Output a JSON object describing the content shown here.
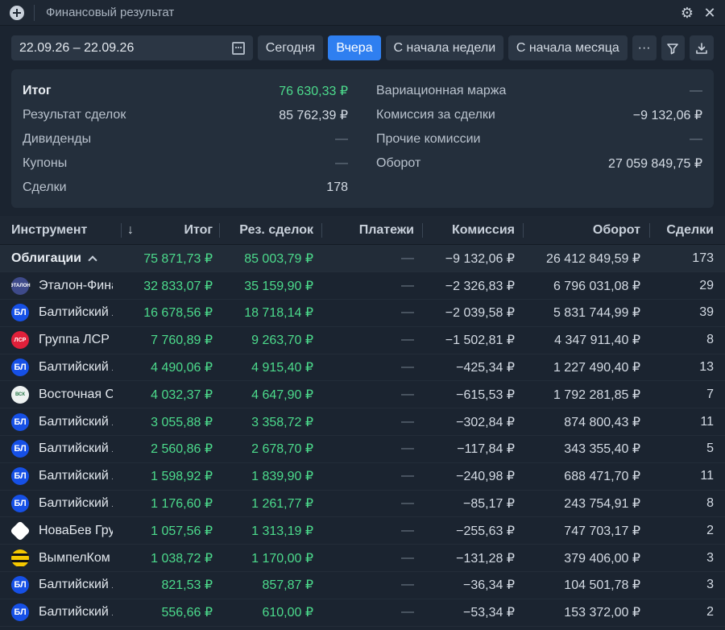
{
  "window": {
    "title": "Финансовый результат"
  },
  "toolbar": {
    "date_range": "22.09.26 – 22.09.26",
    "buttons": [
      "Сегодня",
      "Вчера",
      "С начала недели",
      "С начала месяца"
    ],
    "active_button": "Вчера",
    "more_label": "···"
  },
  "summary": {
    "left": [
      {
        "label": "Итог",
        "value": "76 630,33 ₽"
      },
      {
        "label": "Результат сделок",
        "value": "85 762,39 ₽"
      },
      {
        "label": "Дивиденды",
        "value": "—"
      },
      {
        "label": "Купоны",
        "value": "—"
      },
      {
        "label": "Сделки",
        "value": "178"
      }
    ],
    "right": [
      {
        "label": "Вариационная маржа",
        "value": "—"
      },
      {
        "label": "Комиссия за сделки",
        "value": "−9 132,06 ₽"
      },
      {
        "label": "Прочие комиссии",
        "value": "—"
      },
      {
        "label": "Оборот",
        "value": "27 059 849,75 ₽"
      }
    ]
  },
  "table": {
    "columns": [
      "Инструмент",
      "Итог",
      "Рез. сделок",
      "Платежи",
      "Комиссия",
      "Оборот",
      "Сделки"
    ],
    "sort_indicator": "↓",
    "group": {
      "name": "Облигации",
      "total": "75 871,73 ₽",
      "deals_result": "85 003,79 ₽",
      "payments": "—",
      "commission": "−9 132,06 ₽",
      "turnover": "26 412 849,59 ₽",
      "deals": "173"
    },
    "rows": [
      {
        "logo": "etalon",
        "logo_text": "ЭТАЛОН",
        "name": "Эталон-Финанс",
        "total": "32 833,07 ₽",
        "deals_result": "35 159,90 ₽",
        "payments": "—",
        "commission": "−2 326,83 ₽",
        "turnover": "6 796 031,08 ₽",
        "deals": "29"
      },
      {
        "logo": "bl",
        "logo_text": "БЛ",
        "name": "Балтийский лизинг",
        "total": "16 678,56 ₽",
        "deals_result": "18 718,14 ₽",
        "payments": "—",
        "commission": "−2 039,58 ₽",
        "turnover": "5 831 744,99 ₽",
        "deals": "39"
      },
      {
        "logo": "lsr",
        "logo_text": "ЛСР",
        "name": "Группа ЛСР",
        "total": "7 760,89 ₽",
        "deals_result": "9 263,70 ₽",
        "payments": "—",
        "commission": "−1 502,81 ₽",
        "turnover": "4 347 911,40 ₽",
        "deals": "8"
      },
      {
        "logo": "bl",
        "logo_text": "БЛ",
        "name": "Балтийский лизинг",
        "total": "4 490,06 ₽",
        "deals_result": "4 915,40 ₽",
        "payments": "—",
        "commission": "−425,34 ₽",
        "turnover": "1 227 490,40 ₽",
        "deals": "13"
      },
      {
        "logo": "vsk",
        "logo_text": "ВСК",
        "name": "Восточная Стивидорная",
        "total": "4 032,37 ₽",
        "deals_result": "4 647,90 ₽",
        "payments": "—",
        "commission": "−615,53 ₽",
        "turnover": "1 792 281,85 ₽",
        "deals": "7"
      },
      {
        "logo": "bl",
        "logo_text": "БЛ",
        "name": "Балтийский лизинг",
        "total": "3 055,88 ₽",
        "deals_result": "3 358,72 ₽",
        "payments": "—",
        "commission": "−302,84 ₽",
        "turnover": "874 800,43 ₽",
        "deals": "11"
      },
      {
        "logo": "bl",
        "logo_text": "БЛ",
        "name": "Балтийский лизинг",
        "total": "2 560,86 ₽",
        "deals_result": "2 678,70 ₽",
        "payments": "—",
        "commission": "−117,84 ₽",
        "turnover": "343 355,40 ₽",
        "deals": "5"
      },
      {
        "logo": "bl",
        "logo_text": "БЛ",
        "name": "Балтийский лизинг",
        "total": "1 598,92 ₽",
        "deals_result": "1 839,90 ₽",
        "payments": "—",
        "commission": "−240,98 ₽",
        "turnover": "688 471,70 ₽",
        "deals": "11"
      },
      {
        "logo": "bl",
        "logo_text": "БЛ",
        "name": "Балтийский лизинг",
        "total": "1 176,60 ₽",
        "deals_result": "1 261,77 ₽",
        "payments": "—",
        "commission": "−85,17 ₽",
        "turnover": "243 754,91 ₽",
        "deals": "8"
      },
      {
        "logo": "novabev",
        "logo_text": "",
        "name": "НоваБев Групп",
        "total": "1 057,56 ₽",
        "deals_result": "1 313,19 ₽",
        "payments": "—",
        "commission": "−255,63 ₽",
        "turnover": "747 703,17 ₽",
        "deals": "2"
      },
      {
        "logo": "vimpel",
        "logo_text": "",
        "name": "ВымпелКом",
        "total": "1 038,72 ₽",
        "deals_result": "1 170,00 ₽",
        "payments": "—",
        "commission": "−131,28 ₽",
        "turnover": "379 406,00 ₽",
        "deals": "3"
      },
      {
        "logo": "bl",
        "logo_text": "БЛ",
        "name": "Балтийский лизинг",
        "total": "821,53 ₽",
        "deals_result": "857,87 ₽",
        "payments": "—",
        "commission": "−36,34 ₽",
        "turnover": "104 501,78 ₽",
        "deals": "3"
      },
      {
        "logo": "bl",
        "logo_text": "БЛ",
        "name": "Балтийский лизинг",
        "total": "556,66 ₽",
        "deals_result": "610,00 ₽",
        "payments": "—",
        "commission": "−53,34 ₽",
        "turnover": "153 372,00 ₽",
        "deals": "2"
      }
    ]
  },
  "colors": {
    "positive": "#4cdb8c",
    "accent": "#2f7ff0",
    "background": "#1b2430"
  }
}
